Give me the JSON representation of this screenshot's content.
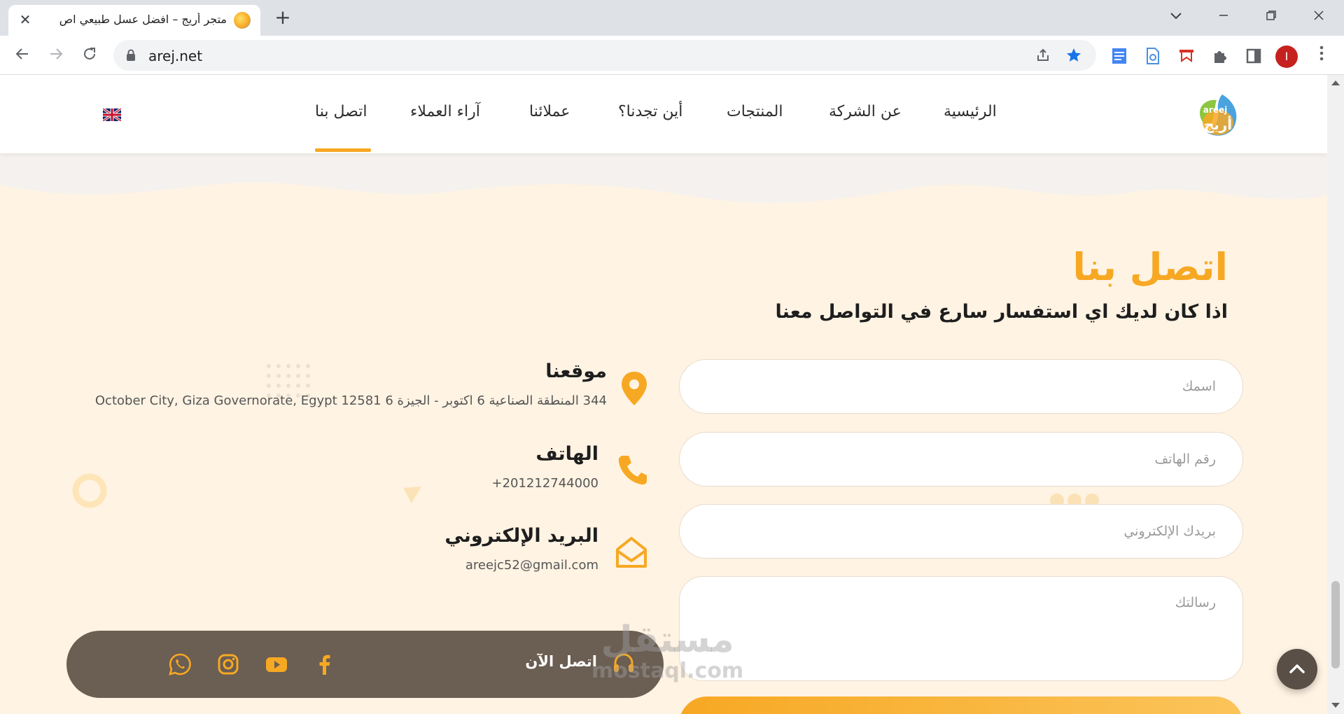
{
  "browser": {
    "tab_title": "متجر أريج – افضل عسل طبيعي اص",
    "url": "arej.net",
    "profile_initial": "I"
  },
  "header": {
    "nav": [
      {
        "label": "الرئيسية",
        "active": false
      },
      {
        "label": "عن الشركة",
        "active": false
      },
      {
        "label": "المنتجات",
        "active": false
      },
      {
        "label": "أين تجدنا؟",
        "active": false
      },
      {
        "label": "عملائنا",
        "active": false
      },
      {
        "label": "آراء العملاء",
        "active": false
      },
      {
        "label": "اتصل بنا",
        "active": true
      }
    ],
    "language_icon": "uk-flag-icon",
    "logo_text": "areej أريج"
  },
  "contact": {
    "title": "اتصل بنا",
    "subtitle": "اذا كان لديك اي استفسار سارع في التواصل معنا",
    "form": {
      "name_placeholder": "اسمك",
      "phone_placeholder": "رقم الهاتف",
      "email_placeholder": "بريدك الإلكتروني",
      "message_placeholder": "رسالتك"
    },
    "location": {
      "title": "موقعنا",
      "text": "344 المنطقة الصناعية 6 اكتوبر - الجيزة October City, Giza Governorate, Egypt 12581 6"
    },
    "phone": {
      "title": "الهاتف",
      "text": "201212744000+"
    },
    "email": {
      "title": "البريد الإلكتروني",
      "text": "areejc52@gmail.com"
    }
  },
  "social_bar": {
    "call_now": "اتصل الآن",
    "icons": [
      "whatsapp-icon",
      "instagram-icon",
      "youtube-icon",
      "facebook-icon",
      "headset-icon"
    ]
  },
  "watermark": {
    "arabic": "مستقل",
    "latin": "mostaql.com"
  },
  "colors": {
    "accent": "#f7a823",
    "page_bg": "#fff3e3",
    "social_bar_bg": "#6b5e52",
    "heading": "#1e1e1e"
  }
}
